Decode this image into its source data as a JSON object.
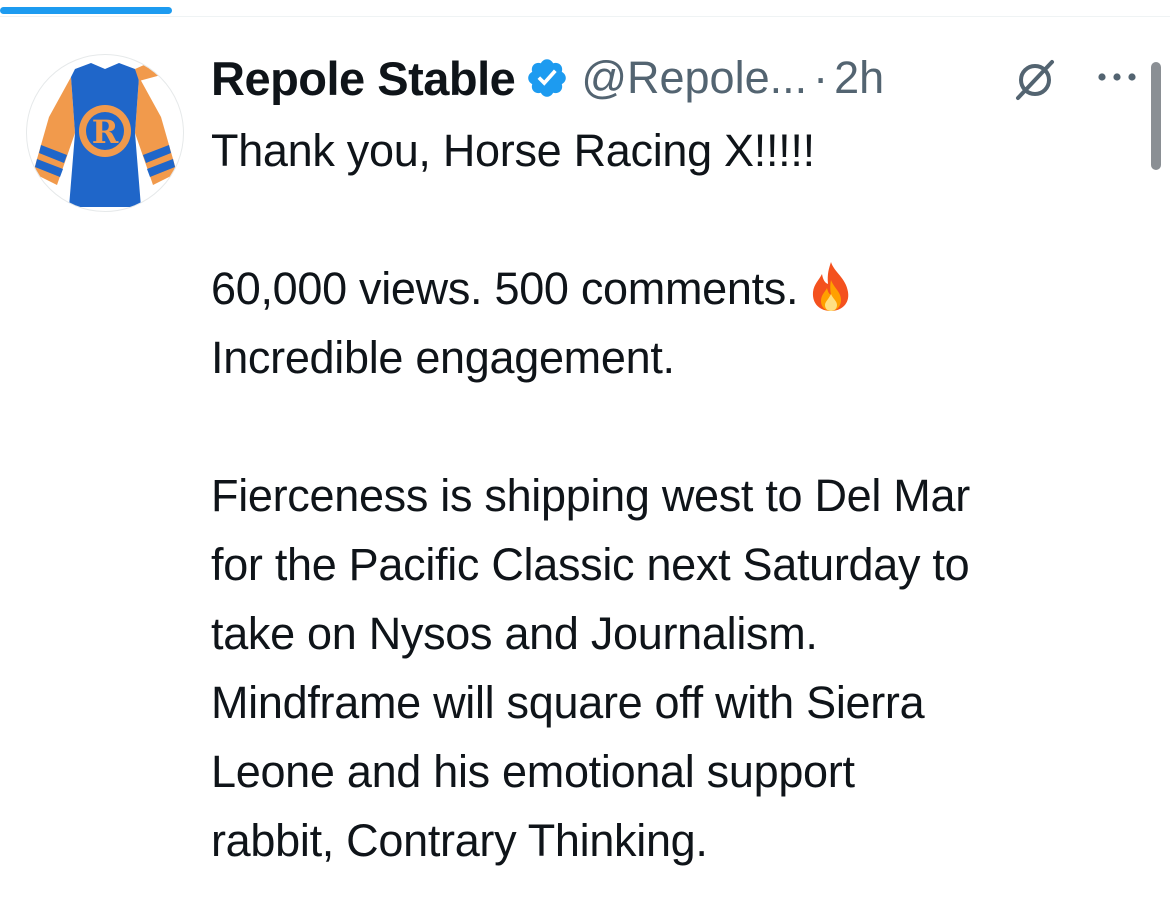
{
  "load_progress": 0.147,
  "colors": {
    "accent": "#1d9bf0",
    "text_primary": "#0f1419",
    "text_secondary": "#536471",
    "silks_blue": "#1f66c9",
    "silks_orange": "#f19a4c"
  },
  "icons": {
    "verified": "verified-badge-icon",
    "grok": "grok-icon",
    "more": "more-horizontal-icon",
    "fire": "fire-emoji-icon",
    "avatar": "jockey-silks-avatar"
  },
  "post": {
    "author": {
      "display_name": "Repole Stable",
      "handle": "@Repole...",
      "avatar_letter": "R"
    },
    "separator": "·",
    "time": "2h",
    "text_lines": [
      "Thank you, Horse Racing X!!!!!",
      "",
      "60,000 views. 500 comments.",
      "Incredible engagement.",
      "",
      "Fierceness is shipping west to Del Mar",
      "for the Pacific Classic next Saturday to",
      "take on Nysos and Journalism.",
      "Mindframe will square off with Sierra",
      "Leone and his emotional support",
      "rabbit, Contrary Thinking."
    ]
  }
}
